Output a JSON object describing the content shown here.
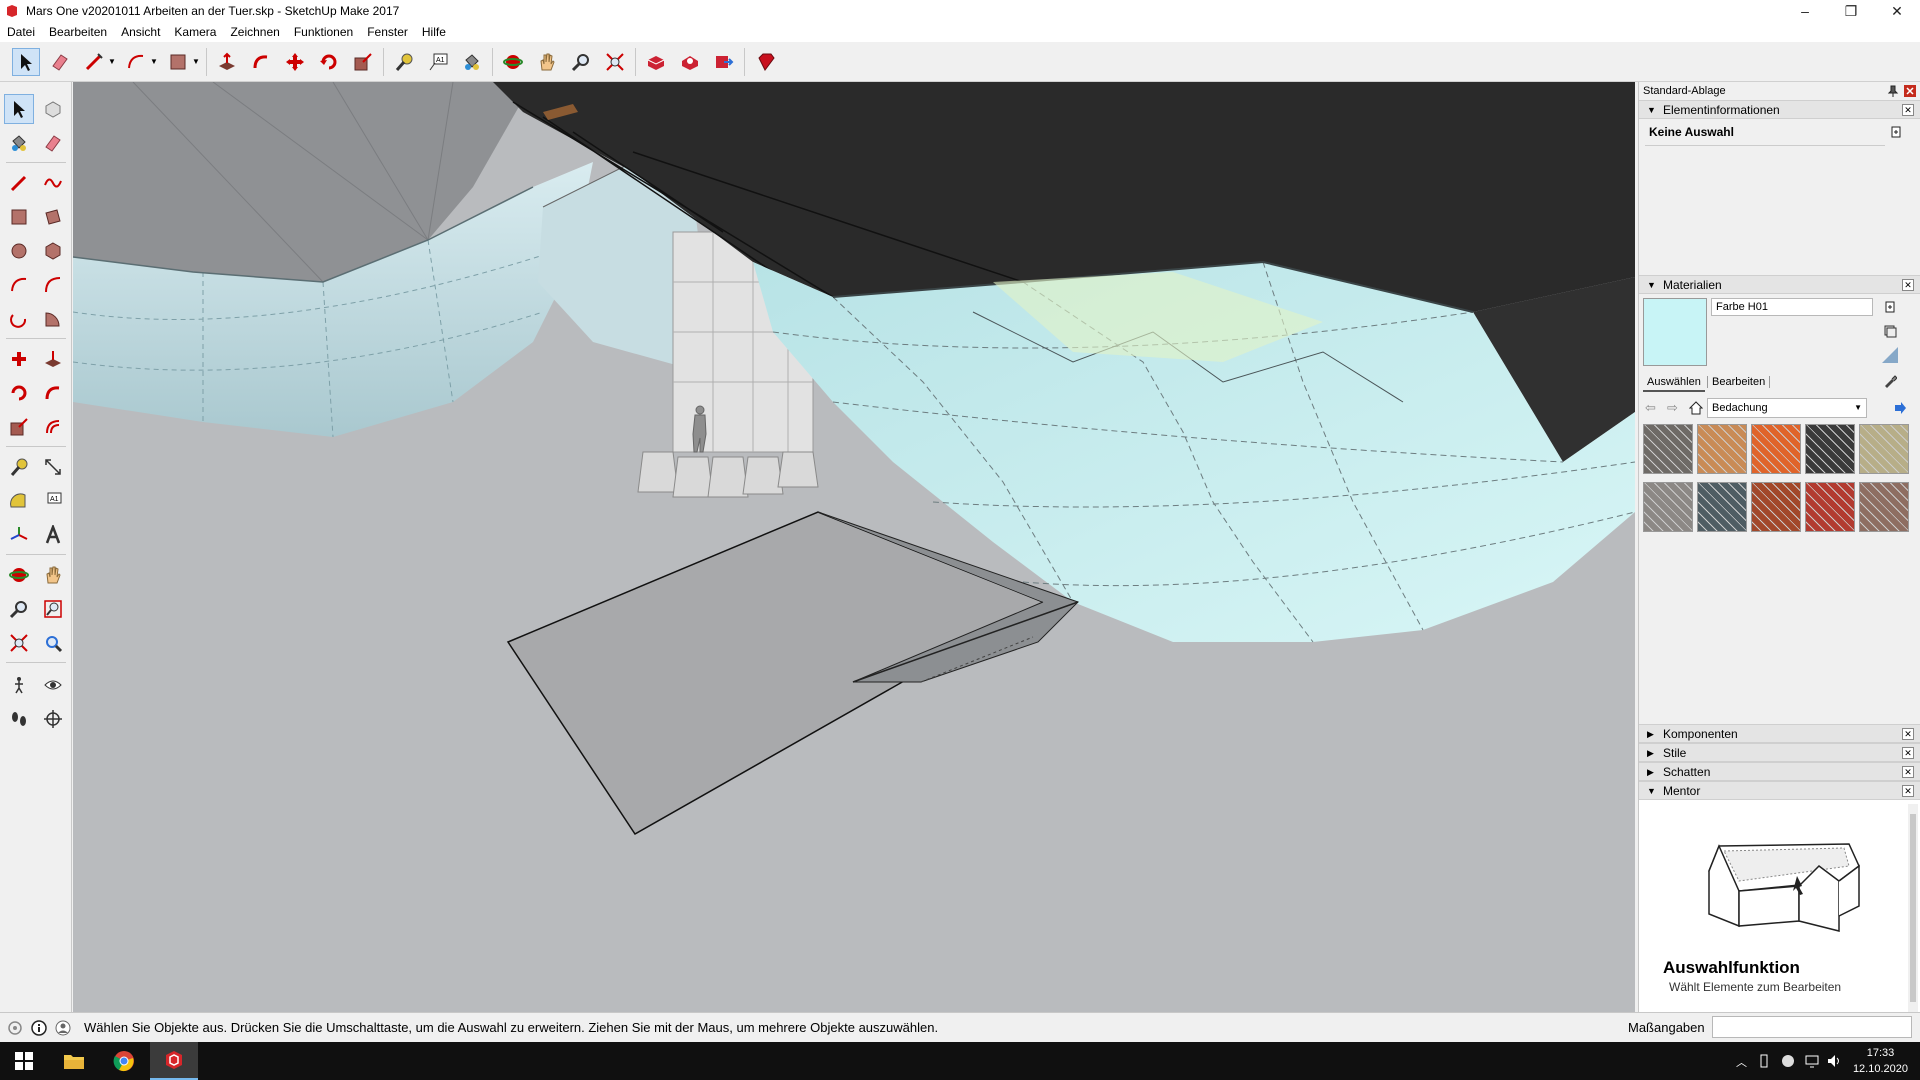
{
  "window": {
    "title": "Mars One v20201011 Arbeiten an der Tuer.skp - SketchUp Make 2017",
    "controls": {
      "minimize": "–",
      "restore": "❐",
      "close": "✕"
    }
  },
  "menu": [
    "Datei",
    "Bearbeiten",
    "Ansicht",
    "Kamera",
    "Zeichnen",
    "Funktionen",
    "Fenster",
    "Hilfe"
  ],
  "toolbar": {
    "tools": [
      "select-icon",
      "eraser-icon",
      "line-icon",
      "arc-icon",
      "rectangle-icon",
      "push-pull-icon",
      "follow-me-icon",
      "move-icon",
      "rotate-icon",
      "scale-icon",
      "tape-measure-icon",
      "text-icon",
      "paint-bucket-icon",
      "orbit-icon",
      "pan-icon",
      "zoom-icon",
      "zoom-extents-icon",
      "warehouse-icon",
      "extension-warehouse-icon",
      "share-model-icon",
      "ruby-icon"
    ]
  },
  "tray": {
    "title": "Standard-Ablage",
    "entity_info": {
      "heading": "Elementinformationen",
      "selection": "Keine Auswahl"
    },
    "materials": {
      "heading": "Materialien",
      "material_name": "Farbe H01",
      "swatch_color": "#c8f4f6",
      "tab_select": "Auswählen",
      "tab_edit": "Bearbeiten",
      "collection": "Bedachung",
      "swatches": [
        "#6e6a66",
        "#c98b56",
        "#e0642a",
        "#3a3a3a",
        "#b7ae88",
        "#8c8885",
        "#4f5d63",
        "#a2482a",
        "#b23b30",
        "#8e6e62"
      ]
    },
    "collapsed_panels": [
      "Komponenten",
      "Stile",
      "Schatten"
    ],
    "mentor": {
      "heading": "Mentor",
      "tool_title": "Auswahlfunktion",
      "tool_desc": "Wählt Elemente zum Bearbeiten"
    }
  },
  "status": {
    "message": "Wählen Sie Objekte aus. Drücken Sie die Umschalttaste, um die Auswahl zu erweitern. Ziehen Sie mit der Maus, um mehrere Objekte auszuwählen.",
    "measurements_label": "Maßangaben"
  },
  "taskbar": {
    "time": "17:33",
    "date": "12.10.2020"
  }
}
